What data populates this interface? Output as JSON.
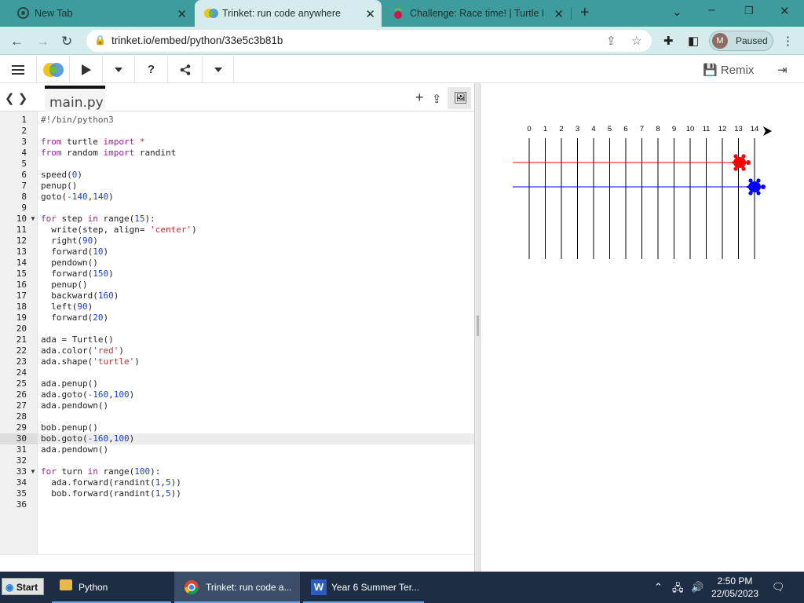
{
  "browser": {
    "tabs": [
      {
        "title": "New Tab",
        "icon": "chrome-icon"
      },
      {
        "title": "Trinket: run code anywhere",
        "icon": "trinket-icon",
        "active": true
      },
      {
        "title": "Challenge: Race time! | Turtle Ra",
        "icon": "raspberry-pi-icon"
      }
    ],
    "url": "trinket.io/embed/python/33e5c3b81b",
    "profile_initial": "M",
    "profile_status": "Paused"
  },
  "toolbar": {
    "remix_label": "Remix",
    "help_label": "?"
  },
  "editor": {
    "filename": "main.py",
    "highlighted_line": 30,
    "folded_lines": [
      10,
      33
    ],
    "lines": [
      "#!/bin/python3",
      "",
      "from turtle import *",
      "from random import randint",
      "",
      "speed(0)",
      "penup()",
      "goto(-140,140)",
      "",
      "for step in range(15):",
      "  write(step, align= 'center')",
      "  right(90)",
      "  forward(10)",
      "  pendown()",
      "  forward(150)",
      "  penup()",
      "  backward(160)",
      "  left(90)",
      "  forward(20)",
      "",
      "ada = Turtle()",
      "ada.color('red')",
      "ada.shape('turtle')",
      "",
      "ada.penup()",
      "ada.goto(-160,100)",
      "ada.pendown()",
      "",
      "bob.penup()",
      "bob.goto(-160,100)",
      "ada.pendown()",
      "",
      "for turn in range(100):",
      "  ada.forward(randint(1,5))",
      "  bob.forward(randint(1,5))",
      ""
    ]
  },
  "output": {
    "track_labels": [
      "0",
      "1",
      "2",
      "3",
      "4",
      "5",
      "6",
      "7",
      "8",
      "9",
      "10",
      "11",
      "12",
      "13",
      "14"
    ],
    "colors": {
      "red_turtle": "#ff0000",
      "blue_turtle": "#0000ff"
    }
  },
  "taskbar": {
    "start_label": "Start",
    "items": [
      {
        "label": "Python",
        "icon": "folder-icon"
      },
      {
        "label": "Trinket: run code a...",
        "icon": "chrome-icon",
        "active": true
      },
      {
        "label": "Year 6 Summer Ter...",
        "icon": "word-icon"
      }
    ],
    "time": "2:50 PM",
    "date": "22/05/2023"
  }
}
